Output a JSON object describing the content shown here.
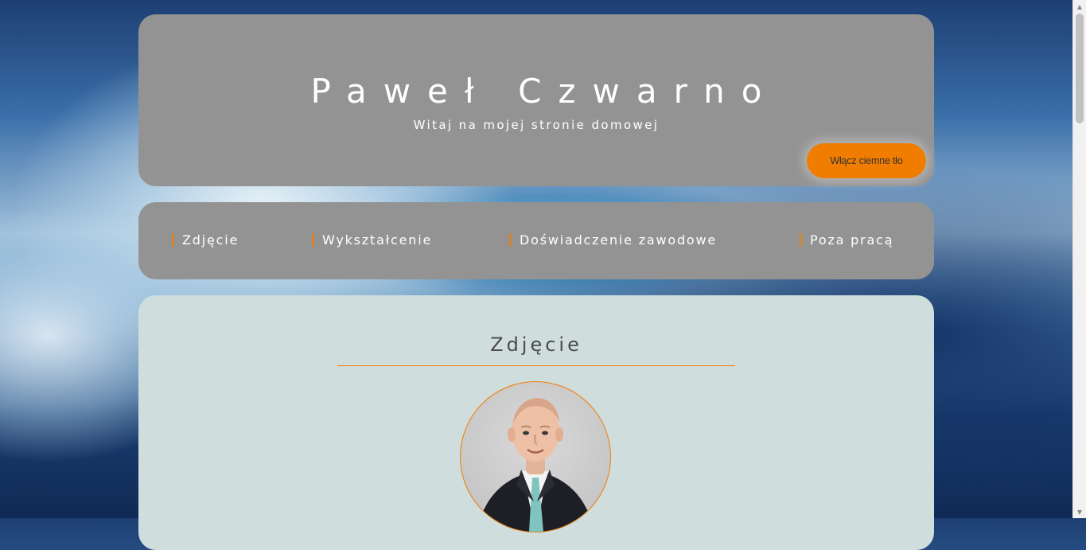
{
  "header": {
    "name": "Paweł Czwarno",
    "subtitle": "Witaj na mojej stronie domowej",
    "dark_mode_button": "Włącz ciemne tło"
  },
  "nav": {
    "items": [
      {
        "label": "Zdjęcie"
      },
      {
        "label": "Wykształcenie"
      },
      {
        "label": "Doświadczenie zawodowe"
      },
      {
        "label": "Poza pracą"
      }
    ]
  },
  "main": {
    "section_title": "Zdjęcie",
    "photo_icon": "portrait-photo"
  },
  "colors": {
    "accent": "#f07d00",
    "card_gray": "#939393",
    "content_bg": "#cfdddc"
  }
}
